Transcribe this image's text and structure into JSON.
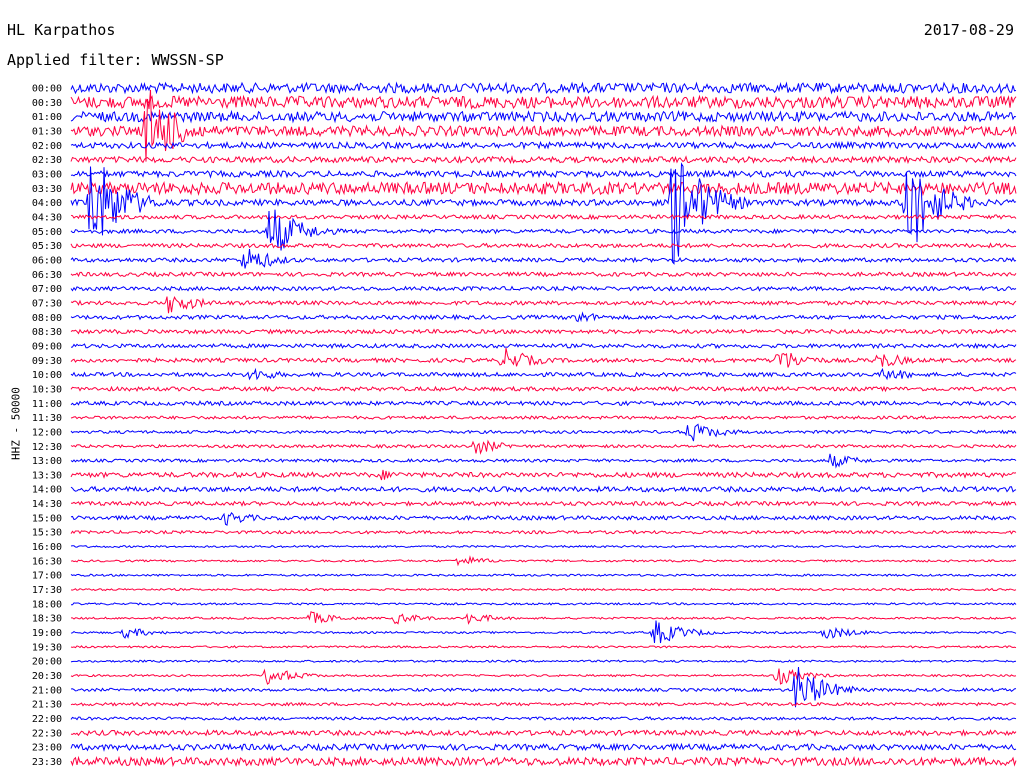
{
  "header": {
    "station": "HL Karpathos",
    "date": "2017-08-29",
    "filter": "Applied filter: WWSSN-SP"
  },
  "chart_data": {
    "type": "line",
    "ylabel": "HHZ - 50000",
    "trace_colors": [
      "#0000ff",
      "#ff0040"
    ],
    "times": [
      "00:00",
      "00:30",
      "01:00",
      "01:30",
      "02:00",
      "02:30",
      "03:00",
      "03:30",
      "04:00",
      "04:30",
      "05:00",
      "05:30",
      "06:00",
      "06:30",
      "07:00",
      "07:30",
      "08:00",
      "08:30",
      "09:00",
      "09:30",
      "10:00",
      "10:30",
      "11:00",
      "11:30",
      "12:00",
      "12:30",
      "13:00",
      "13:30",
      "14:00",
      "14:30",
      "15:00",
      "15:30",
      "16:00",
      "16:30",
      "17:00",
      "17:30",
      "18:00",
      "18:30",
      "19:00",
      "19:30",
      "20:00",
      "20:30",
      "21:00",
      "21:30",
      "22:00",
      "22:30",
      "23:00",
      "23:30"
    ],
    "noise_level": [
      5,
      6,
      5,
      5,
      3,
      3,
      3,
      6,
      3,
      2,
      2,
      2,
      2,
      2,
      2,
      2,
      2,
      2,
      2,
      2,
      2,
      2,
      2,
      1.5,
      1.5,
      1.5,
      1.5,
      2.5,
      2.5,
      2,
      2,
      1.5,
      1,
      1,
      1,
      1,
      1,
      1,
      1,
      1,
      1,
      1,
      1.5,
      1.5,
      1.5,
      2.5,
      3,
      4
    ],
    "events": [
      {
        "row": 3,
        "minute": 2.4,
        "amp": 50
      },
      {
        "row": 8,
        "minute": 0.6,
        "amp": 60
      },
      {
        "row": 8,
        "minute": 19.1,
        "amp": 70
      },
      {
        "row": 8,
        "minute": 26.5,
        "amp": 60
      },
      {
        "row": 10,
        "minute": 6.3,
        "amp": 30
      },
      {
        "row": 12,
        "minute": 5.5,
        "amp": 15
      },
      {
        "row": 15,
        "minute": 3.1,
        "amp": 12
      },
      {
        "row": 16,
        "minute": 15.9,
        "amp": 8
      },
      {
        "row": 19,
        "minute": 13.7,
        "amp": 14
      },
      {
        "row": 19,
        "minute": 22.4,
        "amp": 14
      },
      {
        "row": 19,
        "minute": 25.6,
        "amp": 10
      },
      {
        "row": 20,
        "minute": 5.7,
        "amp": 8
      },
      {
        "row": 20,
        "minute": 25.8,
        "amp": 8
      },
      {
        "row": 24,
        "minute": 19.6,
        "amp": 12
      },
      {
        "row": 25,
        "minute": 12.8,
        "amp": 9
      },
      {
        "row": 26,
        "minute": 24.1,
        "amp": 8
      },
      {
        "row": 27,
        "minute": 9.8,
        "amp": 6
      },
      {
        "row": 30,
        "minute": 4.9,
        "amp": 8
      },
      {
        "row": 33,
        "minute": 12.3,
        "amp": 6
      },
      {
        "row": 37,
        "minute": 7.6,
        "amp": 7
      },
      {
        "row": 37,
        "minute": 10.3,
        "amp": 6
      },
      {
        "row": 37,
        "minute": 12.6,
        "amp": 6
      },
      {
        "row": 38,
        "minute": 1.7,
        "amp": 6
      },
      {
        "row": 38,
        "minute": 18.5,
        "amp": 14
      },
      {
        "row": 38,
        "minute": 23.9,
        "amp": 8
      },
      {
        "row": 41,
        "minute": 6.2,
        "amp": 10
      },
      {
        "row": 41,
        "minute": 22.4,
        "amp": 10
      },
      {
        "row": 42,
        "minute": 23.0,
        "amp": 26
      }
    ]
  }
}
